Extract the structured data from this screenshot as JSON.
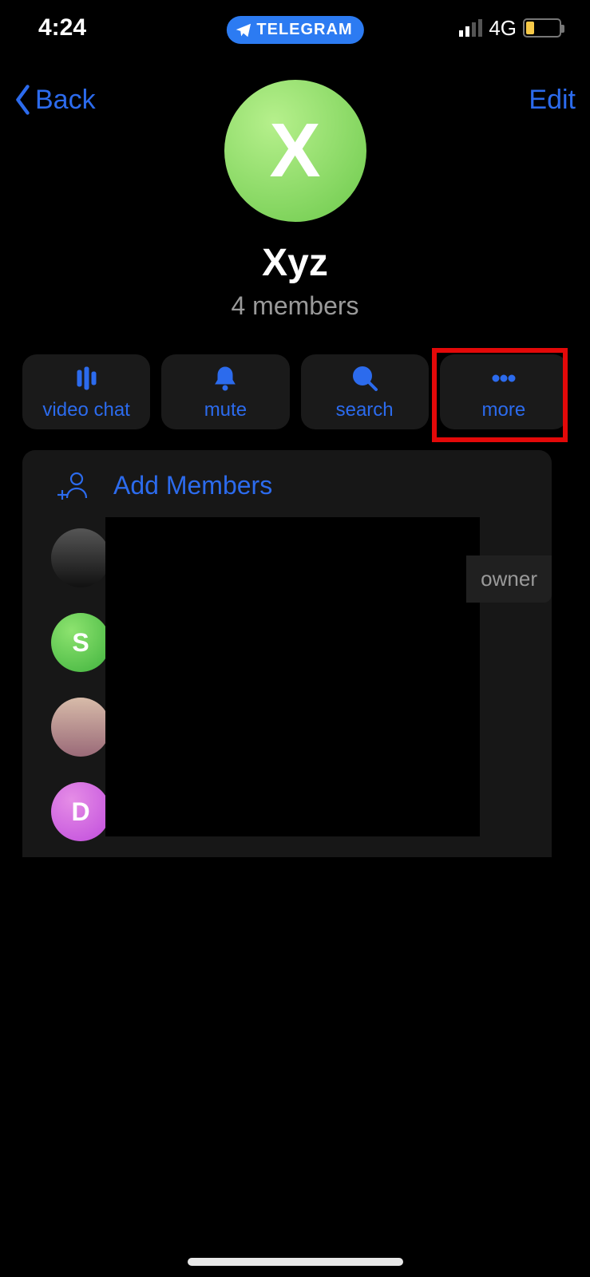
{
  "statusbar": {
    "time": "4:24",
    "app_pill": "TELEGRAM",
    "network": "4G"
  },
  "nav": {
    "back": "Back",
    "edit": "Edit"
  },
  "group": {
    "avatar_initial": "X",
    "name": "Xyz",
    "subtitle": "4 members"
  },
  "actions": {
    "video_chat": "video chat",
    "mute": "mute",
    "search": "search",
    "more": "more"
  },
  "members_panel": {
    "add_label": "Add Members",
    "owner_tag": "owner",
    "members": [
      {
        "initial": "",
        "kind": "photo"
      },
      {
        "initial": "S",
        "kind": "letter"
      },
      {
        "initial": "",
        "kind": "photo"
      },
      {
        "initial": "D",
        "kind": "letter"
      }
    ]
  }
}
